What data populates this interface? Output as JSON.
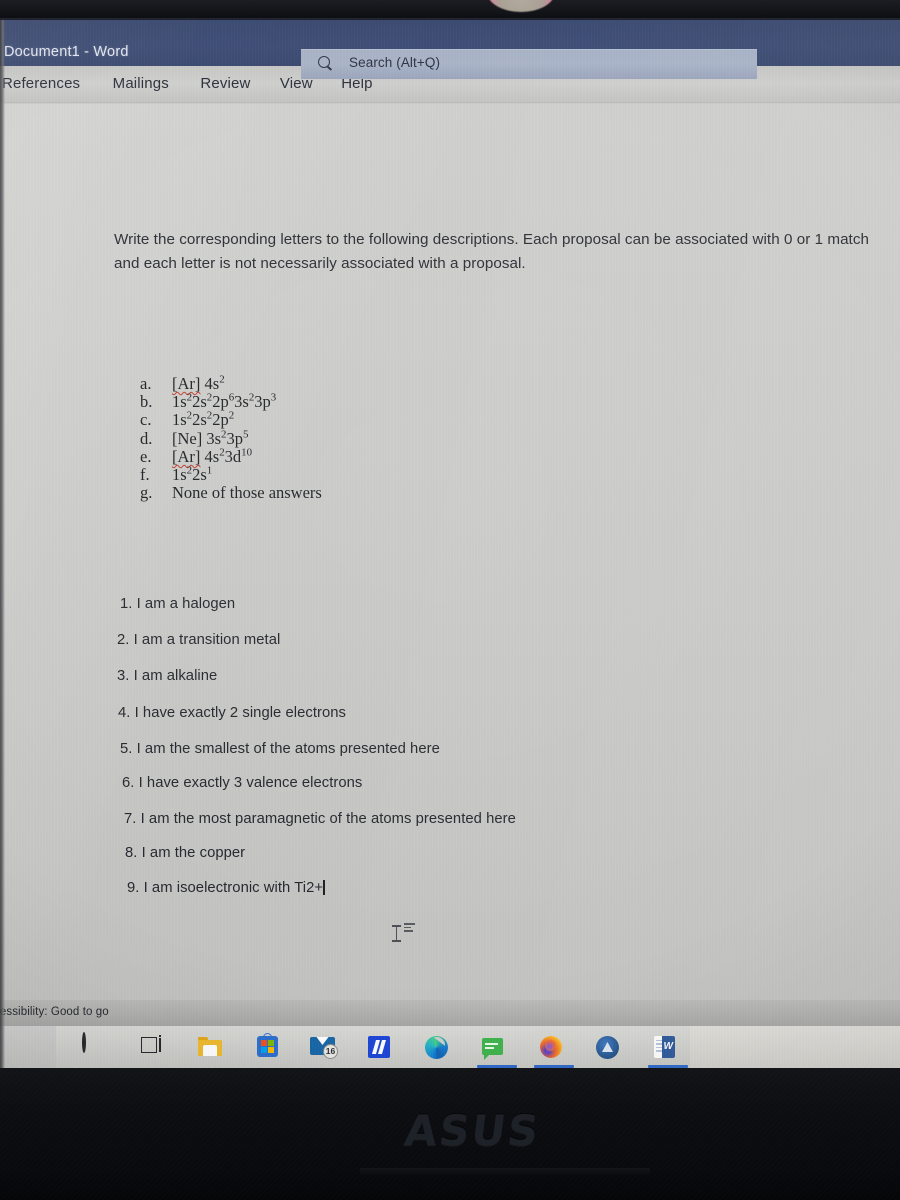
{
  "window": {
    "title": "Document1  -  Word",
    "search": {
      "placeholder": "Search (Alt+Q)",
      "icon": "search-icon"
    },
    "titlebar_color": "#3e4d75"
  },
  "ribbon": {
    "tabs": [
      {
        "label": "References"
      },
      {
        "label": "Mailings"
      },
      {
        "label": "Review"
      },
      {
        "label": "View"
      },
      {
        "label": "Help"
      }
    ]
  },
  "document": {
    "intro_paragraph": "Write the corresponding letters to the following descriptions. Each proposal can be associated with 0 or 1 match and each letter is not necessarily associated with a proposal.",
    "lettered_options": [
      {
        "marker": "a.",
        "segments": [
          {
            "text": "[Ar]",
            "misspelled": true
          },
          {
            "text": " 4s",
            "misspelled": false
          },
          {
            "text": "2",
            "sup": true
          }
        ]
      },
      {
        "marker": "b.",
        "segments": [
          {
            "text": "1s"
          },
          {
            "text": "2",
            "sup": true
          },
          {
            "text": "2s"
          },
          {
            "text": "2",
            "sup": true
          },
          {
            "text": "2p"
          },
          {
            "text": "6",
            "sup": true
          },
          {
            "text": "3s"
          },
          {
            "text": "2",
            "sup": true
          },
          {
            "text": "3p"
          },
          {
            "text": "3",
            "sup": true
          }
        ]
      },
      {
        "marker": "c.",
        "segments": [
          {
            "text": "1s"
          },
          {
            "text": "2",
            "sup": true
          },
          {
            "text": "2s"
          },
          {
            "text": "2",
            "sup": true
          },
          {
            "text": "2p"
          },
          {
            "text": "2",
            "sup": true
          }
        ]
      },
      {
        "marker": "d.",
        "segments": [
          {
            "text": "[Ne] 3s"
          },
          {
            "text": "2",
            "sup": true
          },
          {
            "text": "3p"
          },
          {
            "text": "5",
            "sup": true
          }
        ]
      },
      {
        "marker": "e.",
        "segments": [
          {
            "text": "[Ar]",
            "misspelled": true
          },
          {
            "text": " 4s"
          },
          {
            "text": "2",
            "sup": true
          },
          {
            "text": "3d"
          },
          {
            "text": "10",
            "sup": true
          }
        ]
      },
      {
        "marker": "f.",
        "segments": [
          {
            "text": "1s"
          },
          {
            "text": "2",
            "sup": true
          },
          {
            "text": "2s"
          },
          {
            "text": "1",
            "sup": true
          }
        ]
      },
      {
        "marker": "g.",
        "segments": [
          {
            "text": "None of those answers"
          }
        ]
      }
    ],
    "numbered_statements": [
      "1.  I am a halogen",
      "2. I am a transition metal",
      "3. I am alkaline",
      "4. I have exactly 2 single electrons",
      "5. I am the smallest of the atoms presented here",
      "6. I have exactly 3 valence electrons",
      "7. I am the most paramagnetic of the atoms presented here",
      "8. I am the copper",
      "9. I am isoelectronic with Ti2+"
    ],
    "caret_after_last": true
  },
  "status_bar": {
    "accessibility_text": "cessibility: Good to go"
  },
  "taskbar": {
    "items": [
      {
        "name": "search-icon",
        "label": "Search"
      },
      {
        "name": "task-view-icon",
        "label": "Task View"
      },
      {
        "name": "file-explorer-icon",
        "label": "File Explorer"
      },
      {
        "name": "microsoft-store-icon",
        "label": "Microsoft Store"
      },
      {
        "name": "mail-icon",
        "label": "Mail",
        "badge": "16"
      },
      {
        "name": "blue-app-icon",
        "label": "App"
      },
      {
        "name": "edge-icon",
        "label": "Microsoft Edge"
      },
      {
        "name": "chat-icon",
        "label": "Messaging"
      },
      {
        "name": "firefox-icon",
        "label": "Firefox"
      },
      {
        "name": "blue-circle-icon",
        "label": "App"
      },
      {
        "name": "word-icon",
        "label": "Word",
        "active": true
      }
    ]
  },
  "laptop": {
    "brand": "ASUS"
  }
}
